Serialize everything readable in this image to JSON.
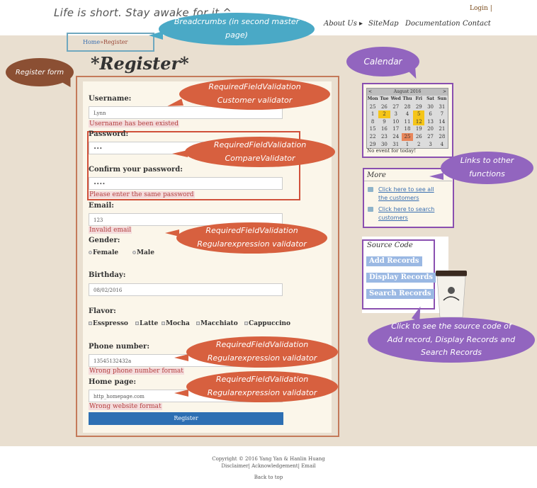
{
  "header": {
    "tagline": "Life is short. Stay awake for it ^",
    "login": "Login |",
    "nav": [
      "About Us",
      "SiteMap",
      "Documentation",
      "Contact"
    ]
  },
  "breadcrumb": {
    "home": "Home",
    "sep": "»",
    "current": "Register"
  },
  "register": {
    "title": "*Register*",
    "username_label": "Username:",
    "username_value": "Lynn",
    "username_error": "Username has been existed",
    "password_label": "Password:",
    "password_value": "•••",
    "confirm_label": "Confirm your password:",
    "confirm_value": "••••",
    "confirm_error": "Please enter the same password",
    "email_label": "Email:",
    "email_value": "123",
    "email_error": "Invalid email",
    "gender_label": "Gender:",
    "gender_options": [
      "Female",
      "Male"
    ],
    "birthday_label": "Birthday:",
    "birthday_value": "08/02/2016",
    "flavor_label": "Flavor:",
    "flavor_options": [
      "Esspresso",
      "Latte",
      "Mocha",
      "Macchiato",
      "Cappuccino"
    ],
    "phone_label": "Phone number:",
    "phone_value": "13545132432a",
    "phone_error": "Wrong phone number format",
    "homepage_label": "Home page:",
    "homepage_value": "http_homepage.com",
    "homepage_error": "Wrong website format",
    "submit": "Register"
  },
  "calendar": {
    "month": "August 2016",
    "prev": "<",
    "next": ">",
    "days": [
      "Mon",
      "Tue",
      "Wed",
      "Thu",
      "Fri",
      "Sat",
      "Sun"
    ],
    "weeks": [
      [
        "25",
        "26",
        "27",
        "28",
        "29",
        "30",
        "31"
      ],
      [
        "1",
        "2",
        "3",
        "4",
        "5",
        "6",
        "7"
      ],
      [
        "8",
        "9",
        "10",
        "11",
        "12",
        "13",
        "14"
      ],
      [
        "15",
        "16",
        "17",
        "18",
        "19",
        "20",
        "21"
      ],
      [
        "22",
        "23",
        "24",
        "25",
        "26",
        "27",
        "28"
      ],
      [
        "29",
        "30",
        "31",
        "1",
        "2",
        "3",
        "4"
      ]
    ],
    "no_event": "No event for today!"
  },
  "more": {
    "title": "More",
    "links": [
      "Click here to see all the customers",
      "Click here to search customers"
    ]
  },
  "source": {
    "title": "Source Code",
    "buttons": [
      "Add Records",
      "Display Records",
      "Search Records"
    ]
  },
  "callouts": {
    "breadcrumbs": "Breadcrumbs (in second master page)",
    "register_form": "Register form",
    "calendar": "Calendar",
    "links": "Links to other functions",
    "source": "Click to see the source code of Add record, Display Records and Search Records",
    "username": "RequiredFieldValidation Customer validator",
    "password": "RequiredFieldValidation CompareValidator",
    "email": "RequiredFieldValidation Regularexpression validator",
    "phone": "RequiredFieldValidation Regularexpression validator",
    "homepage": "RequiredFieldValidation Regularexpression validator"
  },
  "footer": {
    "copyright": "Copyright © 2016 Yang Yan & Hanlin Huang",
    "links": "Disclaimer| Acknowledgement| Email",
    "back": "Back to top"
  },
  "colors": {
    "callout_blue": "#4aa9c6",
    "callout_brown": "#8b4f33",
    "callout_purple": "#9265bf",
    "callout_red": "#d7603f",
    "accent_purple": "#8a4fb0",
    "button_blue": "#2d6fb3"
  }
}
